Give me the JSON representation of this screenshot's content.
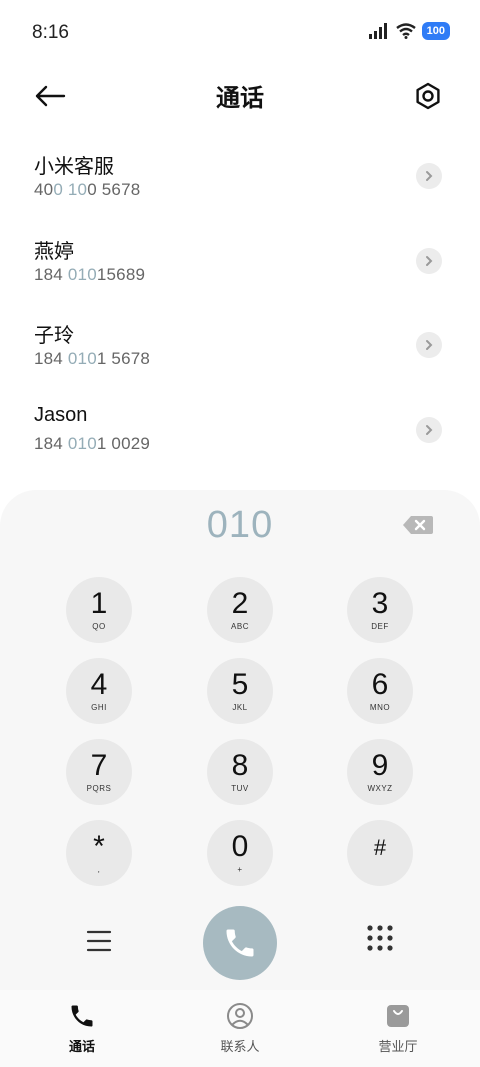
{
  "status_bar": {
    "time": "8:16",
    "battery": "100"
  },
  "header": {
    "title": "通话"
  },
  "contacts": [
    {
      "name": "小米客服",
      "number_parts": [
        "40",
        "0 10",
        "0 5678"
      ]
    },
    {
      "name": "燕婷",
      "number_parts": [
        "184 ",
        "010",
        "15689"
      ]
    },
    {
      "name": "子玲",
      "number_parts": [
        "184 ",
        "010",
        "1 5678"
      ]
    },
    {
      "name": "Jason",
      "number_parts": [
        "184 ",
        "010",
        "1 0029"
      ]
    }
  ],
  "dialpad": {
    "display": "010",
    "keys": [
      {
        "digit": "1",
        "letters": "QO"
      },
      {
        "digit": "2",
        "letters": "ABC"
      },
      {
        "digit": "3",
        "letters": "DEF"
      },
      {
        "digit": "4",
        "letters": "GHI"
      },
      {
        "digit": "5",
        "letters": "JKL"
      },
      {
        "digit": "6",
        "letters": "MNO"
      },
      {
        "digit": "7",
        "letters": "PQRS"
      },
      {
        "digit": "8",
        "letters": "TUV"
      },
      {
        "digit": "9",
        "letters": "WXYZ"
      },
      {
        "digit": "*",
        "letters": ","
      },
      {
        "digit": "0",
        "letters": "+"
      },
      {
        "digit": "#",
        "letters": ""
      }
    ]
  },
  "bottom_nav": {
    "items": [
      {
        "label": "通话",
        "icon": "phone-icon",
        "active": true
      },
      {
        "label": "联系人",
        "icon": "person-icon",
        "active": false
      },
      {
        "label": "营业厅",
        "icon": "bag-icon",
        "active": false
      }
    ]
  },
  "colors": {
    "accent": "#9db3bd",
    "call_button": "#a7bac1",
    "key_bg": "#e9e9e9"
  }
}
